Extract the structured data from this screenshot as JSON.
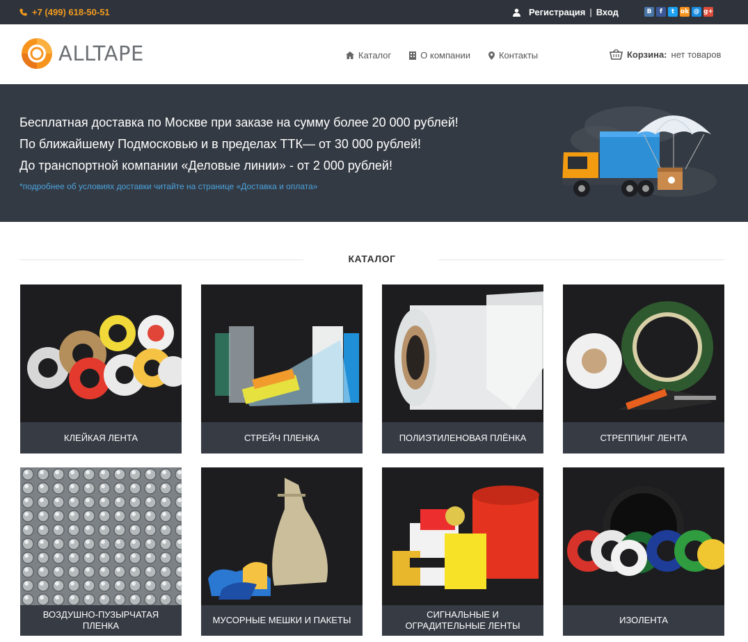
{
  "topbar": {
    "phone": "+7 (499) 618-50-51",
    "register": "Регистрация",
    "separator": "|",
    "login": "Вход",
    "social": [
      {
        "name": "vk",
        "glyph": "B",
        "color": "#4a76a8"
      },
      {
        "name": "facebook",
        "glyph": "f",
        "color": "#3b5998"
      },
      {
        "name": "twitter",
        "glyph": "t",
        "color": "#1da1f2"
      },
      {
        "name": "odnoklassniki",
        "glyph": "ok",
        "color": "#f7931e"
      },
      {
        "name": "mail",
        "glyph": "@",
        "color": "#168de2"
      },
      {
        "name": "google-plus",
        "glyph": "g+",
        "color": "#dd4b39"
      }
    ]
  },
  "header": {
    "logo_text": "ALLTAPE",
    "nav": [
      {
        "label": "Каталог",
        "icon": "home-icon"
      },
      {
        "label": "О компании",
        "icon": "building-icon"
      },
      {
        "label": "Контакты",
        "icon": "map-pin-icon"
      }
    ],
    "cart_label": "Корзина:",
    "cart_value": "нет товаров"
  },
  "banner": {
    "line1": "Бесплатная доставка по Москве при заказе на сумму более 20 000 рублей!",
    "line2": "По ближайшему Подмосковью и в пределах ТТК— от 30 000 рублей!",
    "line3": "До транспортной компании «Деловые линии» - от 2 000 рублей!",
    "note": "*подробнее об условиях доставки читайте на странице «Доставка и оплата»"
  },
  "catalog": {
    "title": "КАТАЛОГ",
    "items": [
      {
        "label": "КЛЕЙКАЯ ЛЕНТА"
      },
      {
        "label": "СТРЕЙЧ ПЛЕНКА"
      },
      {
        "label": "ПОЛИЭТИЛЕНОВАЯ ПЛЁНКА"
      },
      {
        "label": "СТРЕППИНГ ЛЕНТА"
      },
      {
        "label": "ВОЗДУШНО-ПУЗЫРЧАТАЯ ПЛЕНКА"
      },
      {
        "label": "МУСОРНЫЕ МЕШКИ И ПАКЕТЫ"
      },
      {
        "label": "СИГНАЛЬНЫЕ И ОГРАДИТЕЛЬНЫЕ ЛЕНТЫ"
      },
      {
        "label": "ИЗОЛЕНТА"
      }
    ]
  },
  "colors": {
    "accent": "#f29a1e",
    "dark": "#2f343c",
    "banner": "#343a43",
    "caption": "#363b44",
    "link": "#4aa3df"
  }
}
